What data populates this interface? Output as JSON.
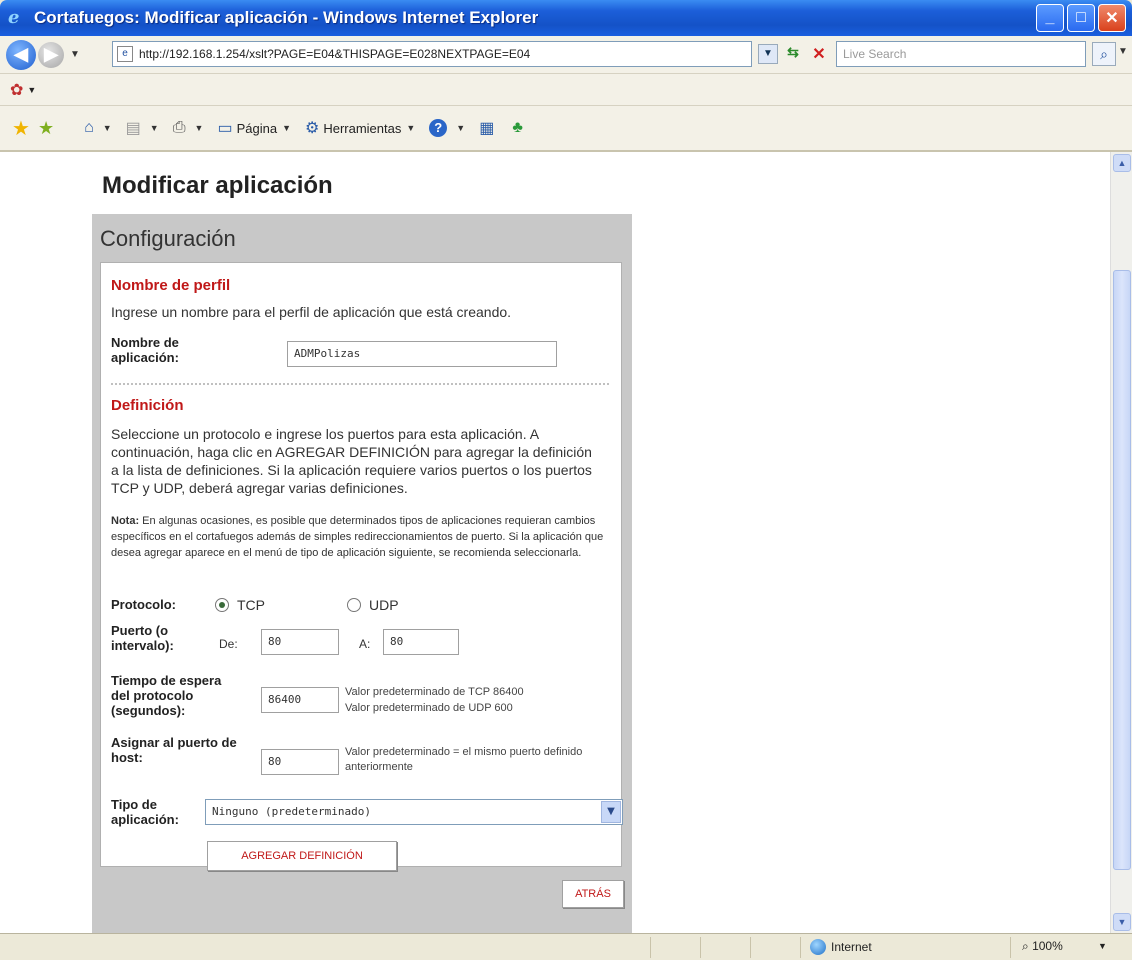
{
  "window": {
    "title": "Cortafuegos: Modificar aplicación - Windows Internet Explorer"
  },
  "browser": {
    "address": "http://192.168.1.254/xslt?PAGE=E04&THISPAGE=E028NEXTPAGE=E04",
    "search_placeholder": "Live Search",
    "command_bar": {
      "page_label": "Página",
      "tools_label": "Herramientas"
    }
  },
  "page": {
    "title": "Modificar aplicación",
    "panel_title": "Configuración",
    "profile_section": {
      "title": "Nombre de perfil",
      "description": "Ingrese un nombre para el perfil de aplicación que está creando.",
      "app_name_label": "Nombre de aplicación:",
      "app_name_value": "ADMPolizas"
    },
    "definition_section": {
      "title": "Definición",
      "description": "Seleccione un protocolo e ingrese los puertos para esta aplicación. A continuación, haga clic en AGREGAR DEFINICIÓN para agregar la definición a la lista de definiciones. Si la aplicación requiere varios puertos o los puertos TCP y UDP, deberá agregar varias definiciones.",
      "note_label": "Nota:",
      "note_text": "En algunas ocasiones, es posible que determinados tipos de aplicaciones requieran cambios específicos en el cortafuegos además de simples redireccionamientos de puerto. Si la aplicación que desea agregar aparece en el menú de tipo de aplicación siguiente, se recomienda seleccionarla.",
      "protocol_label": "Protocolo:",
      "protocol_options": [
        "TCP",
        "UDP"
      ],
      "protocol_selected": "TCP",
      "port_label": "Puerto (o intervalo):",
      "port_from_label": "De:",
      "port_from_value": "80",
      "port_to_label": "A:",
      "port_to_value": "80",
      "timeout_label": "Tiempo de espera del protocolo (segundos):",
      "timeout_value": "86400",
      "timeout_hint_tcp": "Valor predeterminado de TCP 86400",
      "timeout_hint_udp": "Valor predeterminado de UDP 600",
      "host_port_label": "Asignar al puerto de host:",
      "host_port_value": "80",
      "host_port_hint": "Valor predeterminado = el mismo puerto definido anteriormente",
      "app_type_label": "Tipo de aplicación:",
      "app_type_value": "Ninguno (predeterminado)",
      "add_button": "AGREGAR DEFINICIÓN"
    },
    "back_button": "ATRÁS"
  },
  "statusbar": {
    "zone": "Internet",
    "zoom": "100%"
  }
}
